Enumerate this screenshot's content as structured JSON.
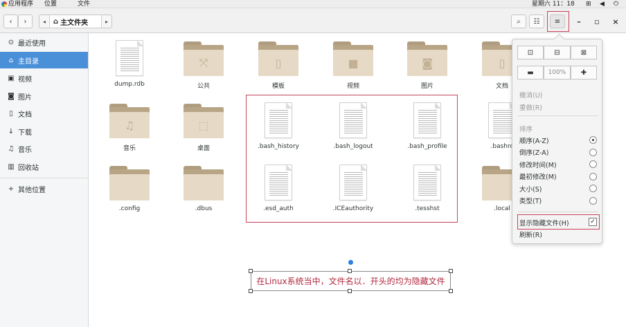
{
  "topbar": {
    "applications": "应用程序",
    "places": "位置",
    "file_menu": "文件",
    "clock": "星期六 11：18"
  },
  "headerbar": {
    "path_home": "主文件夹"
  },
  "sidebar": {
    "items": [
      {
        "label": "最近使用",
        "icon": "clock-icon",
        "glyph": "⊙"
      },
      {
        "label": "主目录",
        "icon": "home-icon",
        "glyph": "⌂"
      },
      {
        "label": "视频",
        "icon": "video-icon",
        "glyph": "▣"
      },
      {
        "label": "图片",
        "icon": "camera-icon",
        "glyph": "◙"
      },
      {
        "label": "文档",
        "icon": "document-icon",
        "glyph": "▯"
      },
      {
        "label": "下载",
        "icon": "download-icon",
        "glyph": "↓"
      },
      {
        "label": "音乐",
        "icon": "music-icon",
        "glyph": "♫"
      },
      {
        "label": "回收站",
        "icon": "trash-icon",
        "glyph": "▥"
      },
      {
        "label": "其他位置",
        "icon": "plus-icon",
        "glyph": "+"
      }
    ],
    "active_index": 1
  },
  "files": [
    {
      "name": "dump.rdb",
      "kind": "document"
    },
    {
      "name": "公共",
      "kind": "folder",
      "emblem": "⤧"
    },
    {
      "name": "模板",
      "kind": "folder",
      "emblem": "▯"
    },
    {
      "name": "视频",
      "kind": "folder",
      "emblem": "■"
    },
    {
      "name": "图片",
      "kind": "folder",
      "emblem": "◙"
    },
    {
      "name": "文档",
      "kind": "folder",
      "emblem": "▯"
    },
    {
      "name": "音乐",
      "kind": "folder",
      "emblem": "♫"
    },
    {
      "name": "桌面",
      "kind": "folder",
      "emblem": "⬚"
    },
    {
      "name": ".bash_history",
      "kind": "document"
    },
    {
      "name": ".bash_logout",
      "kind": "document"
    },
    {
      "name": ".bash_profile",
      "kind": "document"
    },
    {
      "name": ".bashrc",
      "kind": "document"
    },
    {
      "name": ".config",
      "kind": "folder",
      "emblem": ""
    },
    {
      "name": ".dbus",
      "kind": "folder",
      "emblem": ""
    },
    {
      "name": ".esd_auth",
      "kind": "document"
    },
    {
      "name": ".ICEauthority",
      "kind": "document"
    },
    {
      "name": ".tesshst",
      "kind": "document"
    },
    {
      "name": ".local",
      "kind": "folder",
      "emblem": ""
    }
  ],
  "menu": {
    "zoom_level": "100%",
    "undo": "撤消(U)",
    "redo": "重做(R)",
    "sort_heading": "排序",
    "sort_options": [
      {
        "label": "顺序(A-Z)",
        "selected": true
      },
      {
        "label": "倒序(Z-A)",
        "selected": false
      },
      {
        "label": "修改时间(M)",
        "selected": false
      },
      {
        "label": "最初修改(M)",
        "selected": false
      },
      {
        "label": "大小(S)",
        "selected": false
      },
      {
        "label": "类型(T)",
        "selected": false
      }
    ],
    "show_hidden": "显示隐藏文件(H)",
    "show_hidden_checked": true,
    "reload": "刷新(R)"
  },
  "annotation": {
    "text": "在Linux系统当中，文件名以．开头的均为隐藏文件"
  },
  "colors": {
    "accent": "#4a90d9",
    "highlight_border": "#c7435a",
    "annotation_text": "#b0293f"
  }
}
